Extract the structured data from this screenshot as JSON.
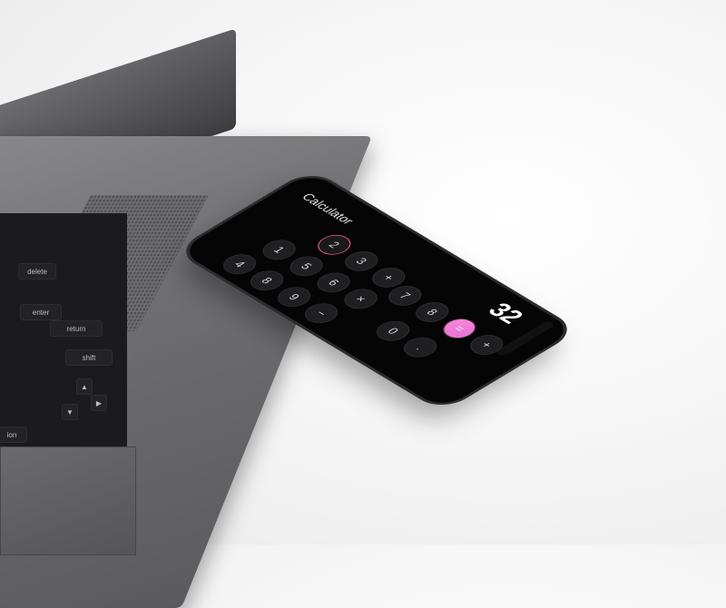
{
  "laptop": {
    "keys": {
      "delete": "delete",
      "enter": "enter",
      "return": "return",
      "shift": "shift",
      "option": "ion"
    }
  },
  "phone": {
    "app_title": "Calculator",
    "display_value": "32",
    "keypad": {
      "row1": [
        "2",
        "3",
        "+"
      ],
      "row2": [
        "1",
        "5",
        "6",
        "×"
      ],
      "row3": [
        "4",
        "8",
        "9",
        "−"
      ],
      "row4": [
        "7",
        "8",
        "=",
        "+"
      ],
      "row5": [
        "0",
        "."
      ]
    },
    "active_key": "2",
    "equals_color": "#e26ed6"
  }
}
